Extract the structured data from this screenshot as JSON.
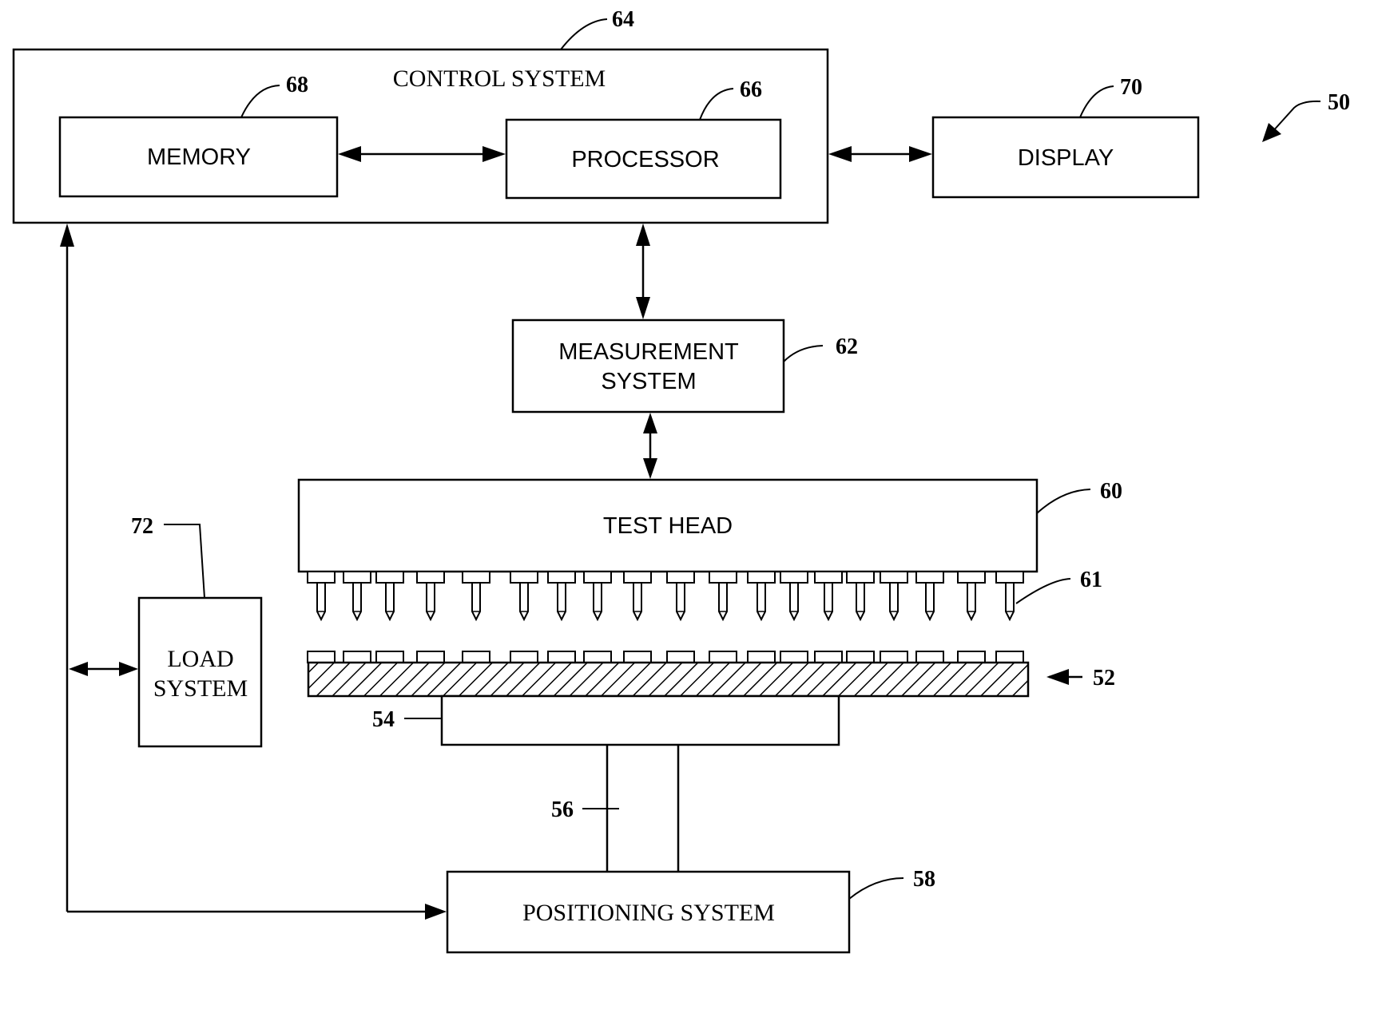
{
  "figure": {
    "system_ref": "50",
    "blocks": {
      "control_system": {
        "label": "CONTROL SYSTEM",
        "ref": "64"
      },
      "memory": {
        "label": "MEMORY",
        "ref": "68"
      },
      "processor": {
        "label": "PROCESSOR",
        "ref": "66"
      },
      "display": {
        "label": "DISPLAY",
        "ref": "70"
      },
      "measurement_system": {
        "label_line1": "MEASUREMENT",
        "label_line2": "SYSTEM",
        "ref": "62"
      },
      "test_head": {
        "label": "TEST HEAD",
        "ref": "60"
      },
      "probes": {
        "ref": "61",
        "count": 19
      },
      "wafer": {
        "ref": "52",
        "pad_count": 19
      },
      "chuck": {
        "ref": "54"
      },
      "shaft": {
        "ref": "56"
      },
      "positioning_system": {
        "label": "POSITIONING SYSTEM",
        "ref": "58"
      },
      "load_system": {
        "label_line1": "LOAD",
        "label_line2": "SYSTEM",
        "ref": "72"
      }
    },
    "connections": [
      {
        "from": "memory",
        "to": "processor",
        "type": "bidirectional"
      },
      {
        "from": "control_system",
        "to": "display",
        "type": "bidirectional"
      },
      {
        "from": "control_system",
        "to": "measurement_system",
        "type": "bidirectional"
      },
      {
        "from": "measurement_system",
        "to": "test_head",
        "type": "bidirectional"
      },
      {
        "from": "control_system",
        "to": "load_system",
        "type": "bidirectional"
      },
      {
        "from": "control_system",
        "to": "positioning_system",
        "type": "bidirectional"
      }
    ]
  }
}
